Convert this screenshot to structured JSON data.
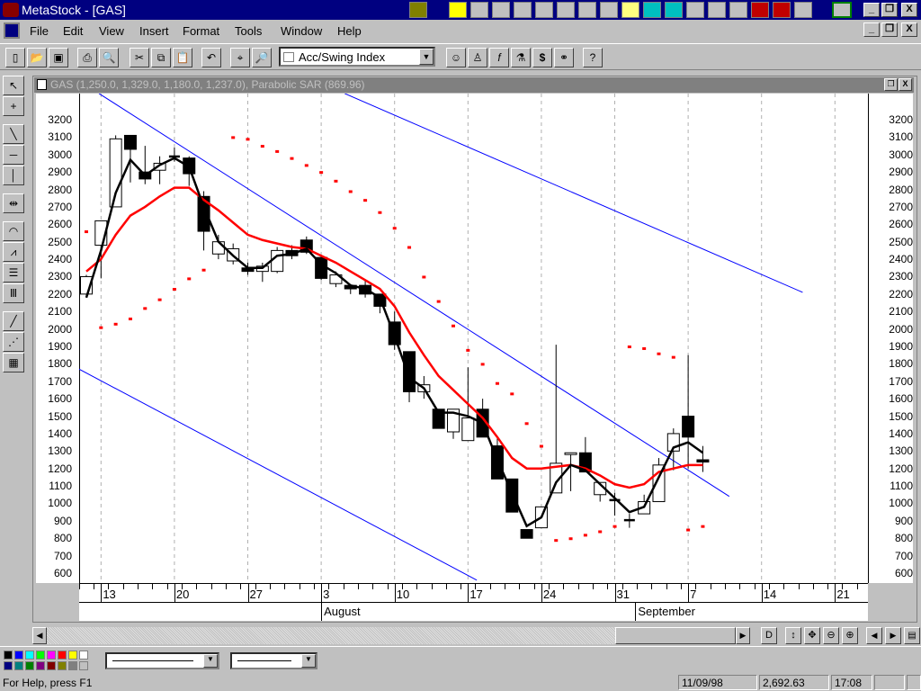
{
  "window": {
    "title": "MetaStock - [GAS]"
  },
  "menu": [
    "File",
    "Edit",
    "View",
    "Insert",
    "Format",
    "Tools",
    "Window",
    "Help"
  ],
  "toolbar": {
    "indicator_select": "Acc/Swing Index"
  },
  "chart_window": {
    "title": "GAS (1,250.0, 1,329.0, 1,180.0, 1,237.0), Parabolic SAR (869.96)"
  },
  "status": {
    "help": "For Help, press F1",
    "date": "11/09/98",
    "value": "2,692.63",
    "time": "17:08"
  },
  "colors": {
    "candle": "#000000",
    "ma_short": "#000000",
    "ma_long": "#ff0000",
    "sar": "#ff0000",
    "trendline": "#0000ff"
  },
  "chart_data": {
    "type": "candlestick",
    "title": "GAS",
    "ylim": [
      550,
      3300
    ],
    "yticks": [
      600,
      700,
      800,
      900,
      1000,
      1100,
      1200,
      1300,
      1400,
      1500,
      1600,
      1700,
      1800,
      1900,
      2000,
      2100,
      2200,
      2300,
      2400,
      2500,
      2600,
      2700,
      2800,
      2900,
      3000,
      3100,
      3200
    ],
    "xticks": [
      {
        "i": 1,
        "label": "13"
      },
      {
        "i": 6,
        "label": "20"
      },
      {
        "i": 11,
        "label": "27"
      },
      {
        "i": 16,
        "label": "3"
      },
      {
        "i": 21,
        "label": "10"
      },
      {
        "i": 26,
        "label": "17"
      },
      {
        "i": 31,
        "label": "24"
      },
      {
        "i": 36,
        "label": "31"
      },
      {
        "i": 41,
        "label": "7"
      },
      {
        "i": 46,
        "label": "14"
      },
      {
        "i": 51,
        "label": "21"
      }
    ],
    "months": [
      {
        "i": 16,
        "label": "August"
      },
      {
        "i": 37.4,
        "label": "September"
      }
    ],
    "ohlc": [
      [
        2200,
        2310,
        2180,
        2300
      ],
      [
        2480,
        2620,
        2290,
        2620
      ],
      [
        2700,
        3110,
        2700,
        3090
      ],
      [
        3110,
        3110,
        2840,
        3030
      ],
      [
        2900,
        3050,
        2830,
        2860
      ],
      [
        2910,
        2990,
        2830,
        2950
      ],
      [
        2990,
        3040,
        2960,
        2990
      ],
      [
        2980,
        2990,
        2820,
        2890
      ],
      [
        2760,
        2790,
        2450,
        2560
      ],
      [
        2430,
        2540,
        2400,
        2500
      ],
      [
        2390,
        2490,
        2370,
        2460
      ],
      [
        2350,
        2380,
        2310,
        2330
      ],
      [
        2330,
        2380,
        2270,
        2360
      ],
      [
        2330,
        2470,
        2320,
        2450
      ],
      [
        2450,
        2480,
        2400,
        2420
      ],
      [
        2510,
        2530,
        2430,
        2440
      ],
      [
        2410,
        2420,
        2280,
        2290
      ],
      [
        2260,
        2330,
        2240,
        2310
      ],
      [
        2250,
        2250,
        2200,
        2230
      ],
      [
        2250,
        2280,
        2180,
        2200
      ],
      [
        2200,
        2200,
        2090,
        2130
      ],
      [
        2040,
        2100,
        1880,
        1910
      ],
      [
        1870,
        1870,
        1580,
        1640
      ],
      [
        1640,
        1730,
        1600,
        1680
      ],
      [
        1540,
        1540,
        1430,
        1430
      ],
      [
        1410,
        1540,
        1370,
        1540
      ],
      [
        1360,
        1780,
        1360,
        1490
      ],
      [
        1540,
        1600,
        1380,
        1380
      ],
      [
        1330,
        1380,
        1140,
        1140
      ],
      [
        1140,
        1140,
        950,
        950
      ],
      [
        850,
        850,
        800,
        800
      ],
      [
        860,
        980,
        860,
        980
      ],
      [
        1060,
        1910,
        1060,
        1230
      ],
      [
        1280,
        1290,
        1070,
        1290
      ],
      [
        1290,
        1380,
        1180,
        1180
      ],
      [
        1050,
        1120,
        1010,
        1120
      ],
      [
        1020,
        1060,
        930,
        1020
      ],
      [
        905,
        940,
        860,
        905
      ],
      [
        940,
        1050,
        940,
        1010
      ],
      [
        1010,
        1260,
        1010,
        1220
      ],
      [
        1300,
        1430,
        1190,
        1400
      ],
      [
        1500,
        1850,
        1200,
        1380
      ],
      [
        1250,
        1329,
        1180,
        1237
      ]
    ],
    "ma_short": [
      2180,
      2450,
      2780,
      2970,
      2880,
      2940,
      2980,
      2930,
      2700,
      2500,
      2420,
      2350,
      2350,
      2420,
      2430,
      2460,
      2370,
      2320,
      2250,
      2230,
      2180,
      1960,
      1720,
      1660,
      1520,
      1520,
      1500,
      1460,
      1250,
      1060,
      870,
      920,
      1120,
      1220,
      1190,
      1110,
      1030,
      950,
      980,
      1150,
      1320,
      1350,
      1290
    ],
    "ma_long": [
      2330,
      2400,
      2540,
      2650,
      2700,
      2760,
      2810,
      2810,
      2740,
      2680,
      2610,
      2540,
      2510,
      2490,
      2470,
      2460,
      2420,
      2380,
      2330,
      2280,
      2230,
      2130,
      1980,
      1850,
      1730,
      1650,
      1570,
      1490,
      1380,
      1260,
      1200,
      1200,
      1210,
      1220,
      1200,
      1160,
      1110,
      1090,
      1110,
      1180,
      1200,
      1220,
      1220
    ],
    "parabolic_sar": [
      2560,
      2010,
      2030,
      2060,
      2120,
      2170,
      2230,
      2290,
      2340,
      null,
      3100,
      3090,
      3050,
      3020,
      2980,
      2940,
      2900,
      2850,
      2790,
      2740,
      2670,
      2580,
      2470,
      2300,
      2160,
      2020,
      1880,
      1800,
      1690,
      1630,
      1460,
      1330,
      790,
      800,
      820,
      840,
      870,
      1900,
      1890,
      1860,
      1840,
      850,
      870
    ],
    "trendlines": [
      [
        [
          0.86,
          3350
        ],
        [
          43.8,
          1040
        ]
      ],
      [
        [
          17.6,
          3350
        ],
        [
          48.8,
          2210
        ]
      ],
      [
        [
          -0.5,
          1770
        ],
        [
          26.6,
          560
        ]
      ]
    ]
  }
}
